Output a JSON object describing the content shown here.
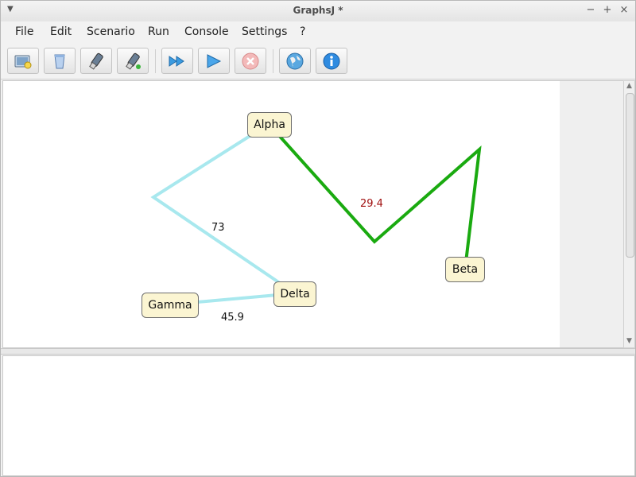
{
  "window": {
    "title": "GraphsJ *"
  },
  "menubar": {
    "items": [
      "File",
      "Edit",
      "Scenario",
      "Run",
      "Console",
      "Settings",
      "?"
    ]
  },
  "toolbar": {
    "buttons": [
      {
        "icon": "new-document-icon",
        "enabled": true
      },
      {
        "icon": "clear-icon",
        "enabled": true
      },
      {
        "icon": "open-usb-icon",
        "enabled": true
      },
      {
        "icon": "save-usb-icon",
        "enabled": true
      },
      {
        "icon": "fast-forward-icon",
        "enabled": true
      },
      {
        "icon": "play-icon",
        "enabled": true
      },
      {
        "icon": "stop-icon",
        "enabled": false
      },
      {
        "icon": "globe-icon",
        "enabled": true
      },
      {
        "icon": "info-icon",
        "enabled": true
      }
    ]
  },
  "graph": {
    "nodes": [
      {
        "label": "Alpha"
      },
      {
        "label": "Beta"
      },
      {
        "label": "Gamma"
      },
      {
        "label": "Delta"
      }
    ],
    "edges": [
      {
        "from": "Alpha",
        "to": "Delta",
        "weight": "73",
        "color": "#a8e8ee",
        "highlighted": false
      },
      {
        "from": "Gamma",
        "to": "Delta",
        "weight": "45.9",
        "color": "#a8e8ee",
        "highlighted": false
      },
      {
        "from": "Alpha",
        "to": "Beta",
        "weight": "29.4",
        "color": "#1aaa10",
        "highlighted": true
      }
    ],
    "colors": {
      "highlight_edge": "#1aaa10",
      "normal_edge": "#a8e8ee",
      "highlight_weight": "#a01010",
      "normal_weight": "#111111",
      "node_fill": "#fbf5d2"
    }
  },
  "console": {
    "text": ""
  }
}
